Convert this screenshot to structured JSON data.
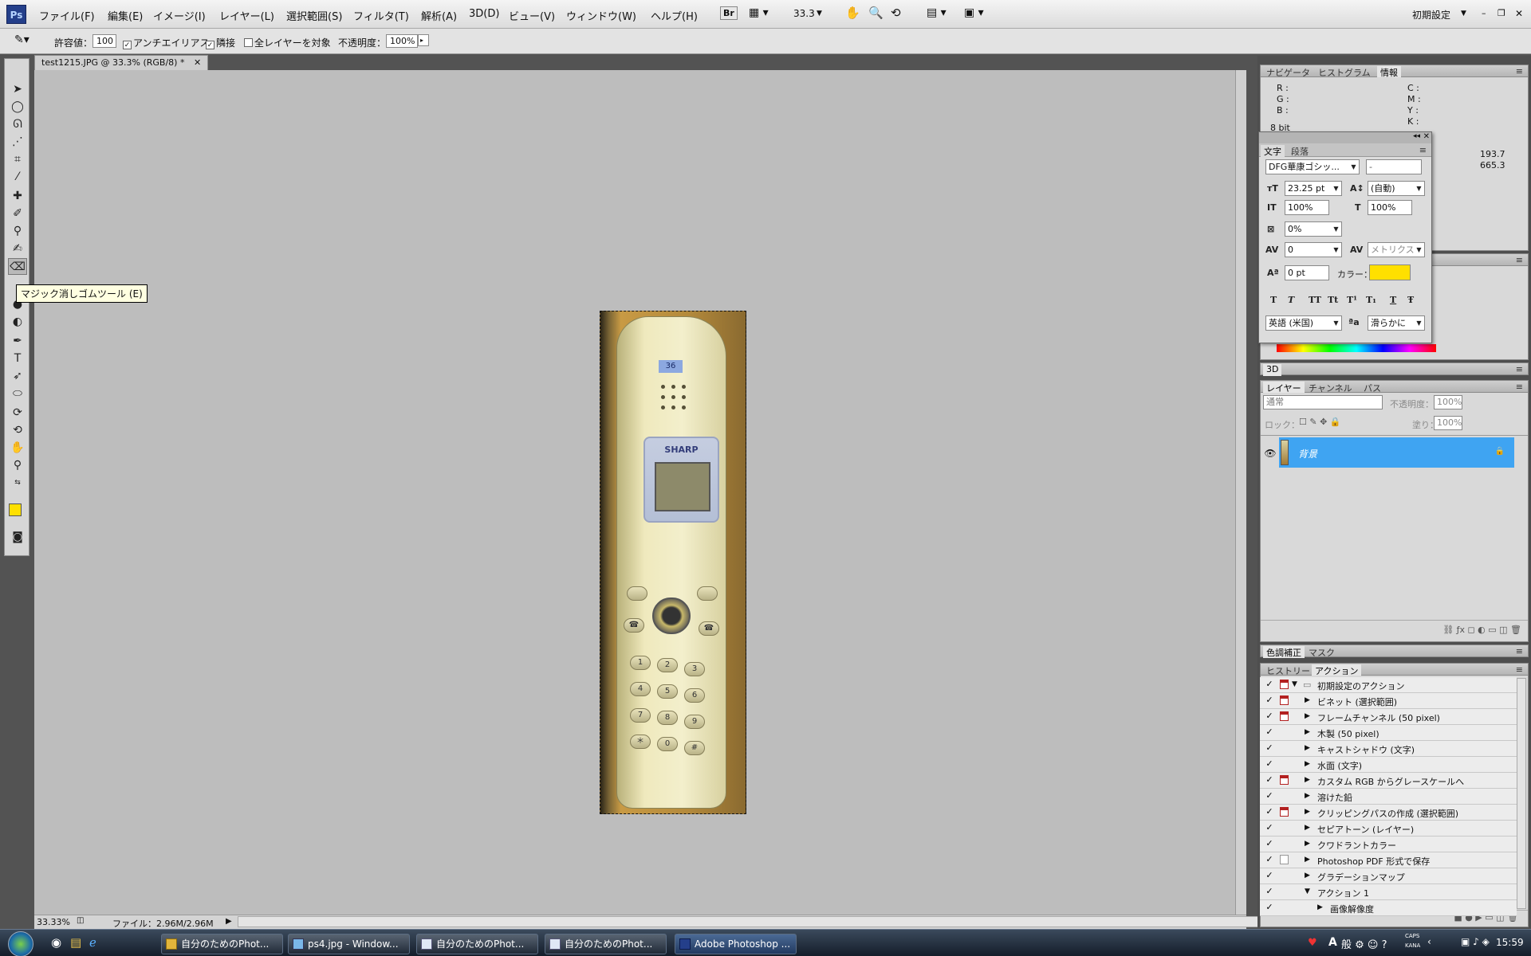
{
  "app": {
    "logo": "Ps",
    "menus": [
      "ファイル(F)",
      "編集(E)",
      "イメージ(I)",
      "レイヤー(L)",
      "選択範囲(S)",
      "フィルタ(T)",
      "解析(A)",
      "3D(D)",
      "ビュー(V)",
      "ウィンドウ(W)",
      "ヘルプ(H)"
    ],
    "zoom": "33.3",
    "br": "Br",
    "workspace": "初期設定"
  },
  "options": {
    "tolerance_label": "許容値：",
    "tolerance_value": "100",
    "antialias_label": "アンチエイリアス",
    "contiguous_label": "隣接",
    "all_layers_label": "全レイヤーを対象",
    "opacity_label": "不透明度：",
    "opacity_value": "100%"
  },
  "document": {
    "tab_title": "test1215.JPG @ 33.3% (RGB/8) *",
    "tooltip": "マジック消しゴムツール (E)",
    "status_zoom": "33.33%",
    "status_file": "ファイル：2.96M/2.96M",
    "photo": {
      "brand": "SHARP",
      "badge": "36",
      "keys": [
        "1",
        "2",
        "3",
        "4",
        "5",
        "6",
        "7",
        "8",
        "9",
        "＊",
        "0",
        "#"
      ]
    }
  },
  "info_panel": {
    "tabs": [
      "ナビゲータ",
      "ヒストグラム",
      "情報"
    ],
    "rgb": [
      "R :",
      "G :",
      "B :"
    ],
    "cmyk": [
      "C :",
      "M :",
      "Y :",
      "K :"
    ],
    "x": "193.7",
    "y": "665.3",
    "bit": "8 bit"
  },
  "char_panel": {
    "tabs": [
      "文字",
      "段落"
    ],
    "font": "DFG華康ゴシッ...",
    "style": "-",
    "size": "23.25 pt",
    "leading": "(自動)",
    "vscale": "100%",
    "hscale": "100%",
    "tsume": "0%",
    "kerning": "0",
    "tracking": "メトリクス",
    "baseline": "0 pt",
    "color_label": "カラー：",
    "color_value": "#ffe000",
    "styles": [
      "T",
      "T",
      "TT",
      "Tt",
      "T¹",
      "T₁",
      "T",
      "Ŧ"
    ],
    "language": "英語 (米国)",
    "aa_label": "ªa",
    "antialias": "滑らかに"
  },
  "panel_3d": {
    "title": "3D"
  },
  "layers_panel": {
    "tabs": [
      "レイヤー",
      "チャンネル",
      "パス"
    ],
    "blend_mode": "通常",
    "opacity_label": "不透明度：",
    "opacity_value": "100%",
    "lock_label": "ロック：",
    "fill_label": "塗り：",
    "fill_value": "100%",
    "layer_name": "背景"
  },
  "adjust_panel": {
    "tabs": [
      "色調補正",
      "マスク"
    ]
  },
  "actions_panel": {
    "tabs": [
      "ヒストリー",
      "アクション"
    ],
    "items": [
      {
        "label": "初期設定のアクション",
        "dialog": "red",
        "level": 0,
        "expanded": true
      },
      {
        "label": "ビネット (選択範囲)",
        "dialog": "red",
        "level": 1
      },
      {
        "label": "フレームチャンネル (50 pixel)",
        "dialog": "red",
        "level": 1
      },
      {
        "label": "木製 (50 pixel)",
        "dialog": "none",
        "level": 1
      },
      {
        "label": "キャストシャドウ (文字)",
        "dialog": "none",
        "level": 1
      },
      {
        "label": "水面 (文字)",
        "dialog": "none",
        "level": 1
      },
      {
        "label": "カスタム RGB からグレースケールへ",
        "dialog": "red",
        "level": 1
      },
      {
        "label": "溶けた鉛",
        "dialog": "none",
        "level": 1
      },
      {
        "label": "クリッピングパスの作成 (選択範囲)",
        "dialog": "red",
        "level": 1
      },
      {
        "label": "セピアトーン (レイヤー)",
        "dialog": "none",
        "level": 1
      },
      {
        "label": "クワドラントカラー",
        "dialog": "none",
        "level": 1
      },
      {
        "label": "Photoshop PDF 形式で保存",
        "dialog": "box",
        "level": 1
      },
      {
        "label": "グラデーションマップ",
        "dialog": "none",
        "level": 1
      },
      {
        "label": "アクション 1",
        "dialog": "none",
        "level": 1,
        "expanded": true
      },
      {
        "label": "画像解像度",
        "dialog": "none",
        "level": 2
      }
    ]
  },
  "taskbar": {
    "buttons": [
      "自分のためのPhot...",
      "ps4.jpg - Window...",
      "自分のためのPhot...",
      "自分のためのPhot...",
      "Adobe Photoshop ..."
    ],
    "tray_caps": "CAPS",
    "tray_kana": "KANA",
    "ime": "A",
    "clock": "15:59"
  },
  "colors": {
    "foreground": "#ffe000",
    "background": "#ffffff",
    "selection": "#3fa4f2"
  }
}
